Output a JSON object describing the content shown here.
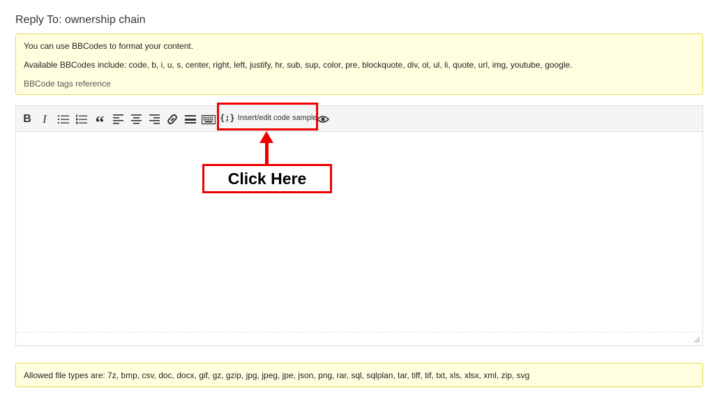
{
  "page": {
    "title": "Reply To: ownership chain"
  },
  "bbcode_notice": {
    "line1": "You can use BBCodes to format your content.",
    "line2": "Available BBCodes include: code, b, i, u, s, center, right, left, justify, hr, sub, sup, color, pre, blockquote, div, ol, ul, li, quote, url, img, youtube, google.",
    "reference_link": "BBCode tags reference"
  },
  "toolbar": {
    "bold": "B",
    "italic": "I",
    "quote": "“",
    "codesample_icon": "{;}",
    "codesample_label": "Insert/edit code sample",
    "icons": [
      "bold-icon",
      "italic-icon",
      "bullet-list-icon",
      "numbered-list-icon",
      "blockquote-icon",
      "align-left-icon",
      "align-center-icon",
      "align-right-icon",
      "link-icon",
      "horizontal-rule-icon",
      "keyboard-icon",
      "code-sample-icon",
      "preview-eye-icon"
    ]
  },
  "annotation": {
    "callout_text": "Click Here",
    "color": "#ee0000"
  },
  "filetypes_notice": {
    "text": "Allowed file types are: 7z, bmp, csv, doc, docx, gif, gz, gzip, jpg, jpeg, jpe, json, png, rar, sql, sqlplan, tar, tiff, tif, txt, xls, xlsx, xml, zip, svg"
  }
}
